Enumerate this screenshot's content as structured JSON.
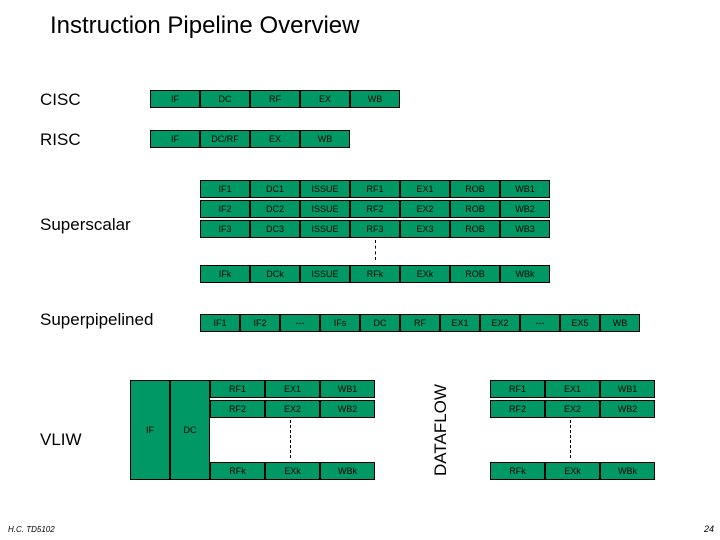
{
  "title": "Instruction Pipeline Overview",
  "labels": {
    "cisc": "CISC",
    "risc": "RISC",
    "superscalar": "Superscalar",
    "superpipelined": "Superpipelined",
    "vliw": "VLIW",
    "dataflow": "DATAFLOW"
  },
  "cisc": {
    "s0": "IF",
    "s1": "DC",
    "s2": "RF",
    "s3": "EX",
    "s4": "WB"
  },
  "risc": {
    "s0": "IF",
    "s1": "DC/RF",
    "s2": "EX",
    "s3": "WB"
  },
  "superscalar": {
    "r0": {
      "c0": "IF1",
      "c1": "DC1",
      "c2": "ISSUE",
      "c3": "RF1",
      "c4": "EX1",
      "c5": "ROB",
      "c6": "WB1"
    },
    "r1": {
      "c0": "IF2",
      "c1": "DC2",
      "c2": "ISSUE",
      "c3": "RF2",
      "c4": "EX2",
      "c5": "ROB",
      "c6": "WB2"
    },
    "r2": {
      "c0": "IF3",
      "c1": "DC3",
      "c2": "ISSUE",
      "c3": "RF3",
      "c4": "EX3",
      "c5": "ROB",
      "c6": "WB3"
    },
    "rk": {
      "c0": "IFk",
      "c1": "DCk",
      "c2": "ISSUE",
      "c3": "RFk",
      "c4": "EXk",
      "c5": "ROB",
      "c6": "WBk"
    }
  },
  "superpipelined": {
    "s0": "IF1",
    "s1": "IF2",
    "s2": "---",
    "s3": "IFs",
    "s4": "DC",
    "s5": "RF",
    "s6": "EX1",
    "s7": "EX2",
    "s8": "---",
    "s9": "EX5",
    "s10": "WB"
  },
  "vliw": {
    "if": "IF",
    "dc": "DC",
    "left": {
      "r0": {
        "c0": "RF1",
        "c1": "EX1",
        "c2": "WB1"
      },
      "r1": {
        "c0": "RF2",
        "c1": "EX2",
        "c2": "WB2"
      },
      "rk": {
        "c0": "RFk",
        "c1": "EXk",
        "c2": "WBk"
      }
    },
    "right": {
      "r0": {
        "c0": "RF1",
        "c1": "EX1",
        "c2": "WB1"
      },
      "r1": {
        "c0": "RF2",
        "c1": "EX2",
        "c2": "WB2"
      },
      "rk": {
        "c0": "RFk",
        "c1": "EXk",
        "c2": "WBk"
      }
    }
  },
  "footer": {
    "left": "H.C. TD5102",
    "right": "24"
  }
}
